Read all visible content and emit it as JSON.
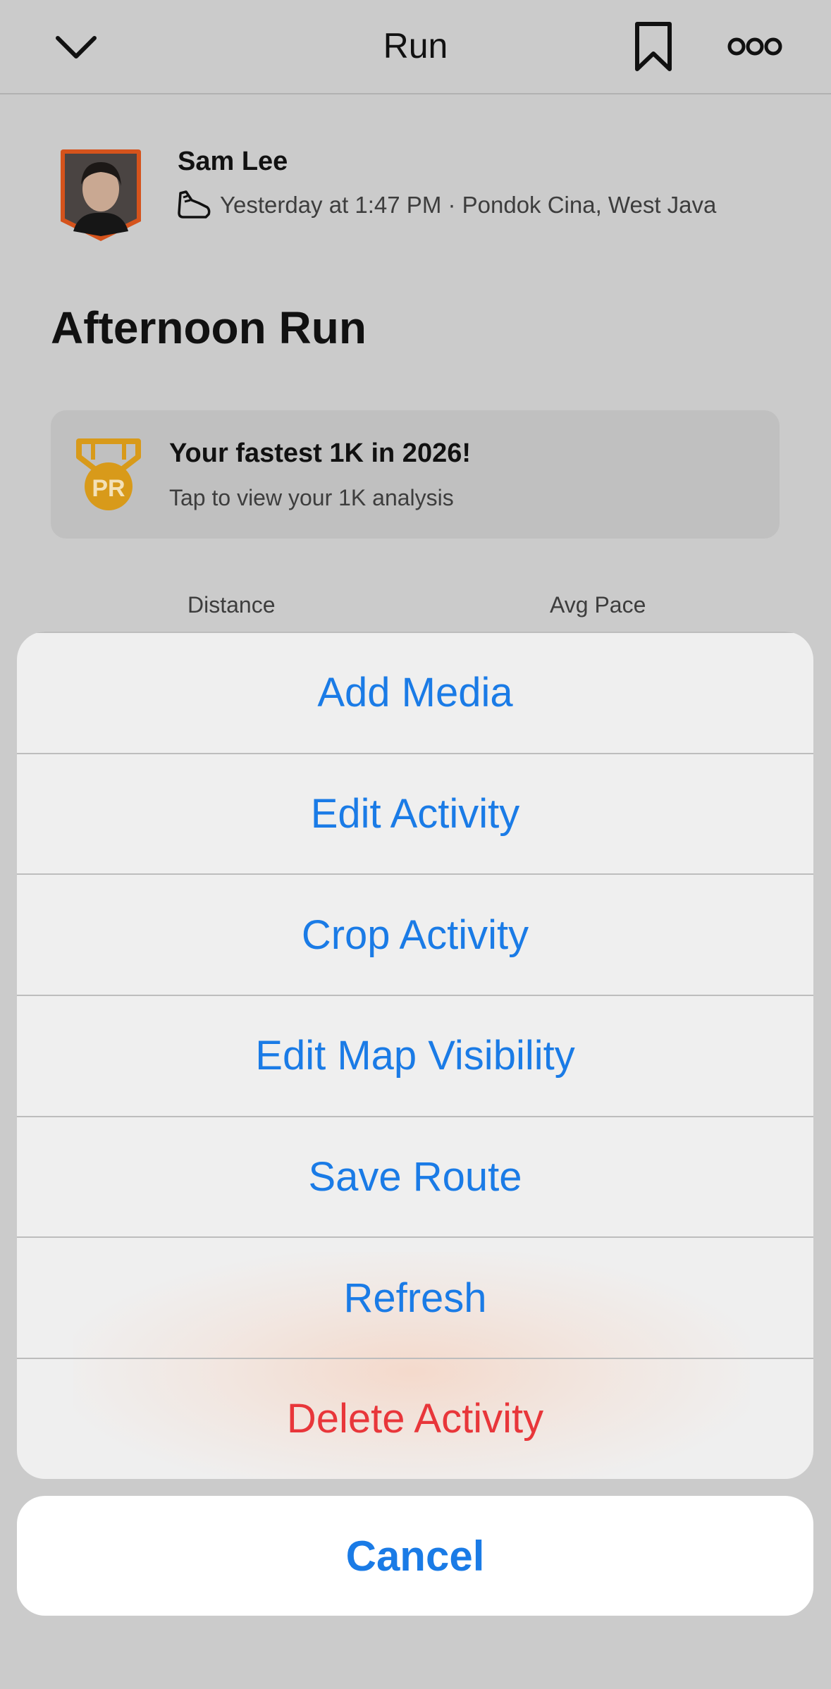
{
  "header": {
    "title": "Run",
    "back_icon": "chevron-down-icon",
    "bookmark_icon": "bookmark-icon",
    "more_icon": "more-horizontal-icon"
  },
  "athlete": {
    "name": "Sam Lee",
    "meta": "Yesterday at 1:47 PM · Pondok Cina, West Java",
    "activity_icon": "running-shoe-icon"
  },
  "activity": {
    "title": "Afternoon Run"
  },
  "pr_card": {
    "badge_text": "PR",
    "title": "Your fastest 1K in 2026!",
    "subtitle": "Tap to view your 1K analysis",
    "medal_color": "#d89a1a"
  },
  "stats": {
    "distance_label": "Distance",
    "pace_label": "Avg Pace"
  },
  "action_sheet": {
    "items": [
      {
        "label": "Add Media"
      },
      {
        "label": "Edit Activity"
      },
      {
        "label": "Crop Activity"
      },
      {
        "label": "Edit Map Visibility"
      },
      {
        "label": "Save Route"
      },
      {
        "label": "Refresh"
      },
      {
        "label": "Delete Activity"
      }
    ],
    "cancel_label": "Cancel"
  },
  "colors": {
    "action": "#1a7be6",
    "destructive": "#e8363a",
    "dim_background": "#cbcbcb"
  }
}
